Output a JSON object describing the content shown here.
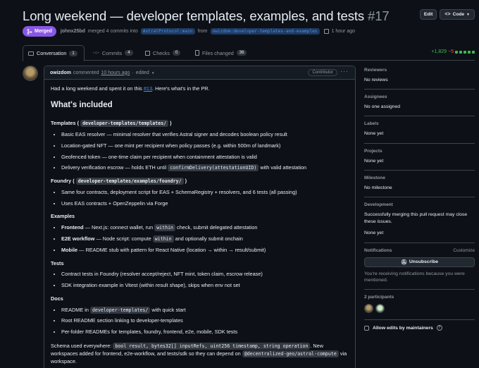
{
  "pr": {
    "title": "Long weekend — developer templates, examples, and tests",
    "number": "#17",
    "state": "Merged",
    "author": "johnx25bd",
    "merged_text": "merged 4 commits into",
    "base_branch": "AstralProtocol:main",
    "from_text": "from",
    "head_branch": "owizdom:developer-templates-and-examples",
    "time": "1 hour ago"
  },
  "header_buttons": {
    "edit": "Edit",
    "code": "Code"
  },
  "tabs": [
    {
      "label": "Conversation",
      "count": "1"
    },
    {
      "label": "Commits",
      "count": "4"
    },
    {
      "label": "Checks",
      "count": "0"
    },
    {
      "label": "Files changed",
      "count": "36"
    }
  ],
  "diffstat": {
    "additions": "+1,829",
    "deletions": "−5"
  },
  "comment": {
    "author": "owizdom",
    "action": "commented",
    "time": "10 hours ago",
    "sep": "·",
    "edited": "edited",
    "role": "Contributor",
    "intro_pre": "Had a long weekend and spent it on this ",
    "intro_link": "#13",
    "intro_post": ". Here's what's in the PR.",
    "heading": "What's included",
    "templates": {
      "label": "Templates",
      "path": "developer-templates/templates/",
      "items": [
        "Basic EAS resolver — minimal resolver that verifies Astral signer and decodes boolean policy result",
        "Location-gated NFT — one mint per recipient when policy passes (e.g. within 500m of landmark)",
        "Geofenced token — one-time claim per recipient when containment attestation is valid"
      ],
      "escrow_pre": "Delivery verification escrow — holds ETH until ",
      "escrow_code": "confirmDelivery(attestationUID)",
      "escrow_post": " with valid attestation"
    },
    "foundry": {
      "label": "Foundry",
      "path": "developer-templates/examples/foundry/",
      "items": [
        "Same four contracts, deployment script for EAS + SchemaRegistry + resolvers, and 6 tests (all passing)",
        "Uses EAS contracts + OpenZeppelin via Forge"
      ]
    },
    "examples": {
      "label": "Examples",
      "frontend_b": "Frontend",
      "frontend_pre": " — Next.js: connect wallet, run ",
      "frontend_code": "within",
      "frontend_post": " check, submit delegated attestation",
      "e2e_b": "E2E workflow",
      "e2e_pre": " — Node script: compute ",
      "e2e_code": "within",
      "e2e_post": " and optionally submit onchain",
      "mobile_b": "Mobile",
      "mobile_post": " — README stub with pattern for React Native (location → within → result/submit)"
    },
    "tests": {
      "label": "Tests",
      "items": [
        "Contract tests in Foundry (resolver accept/reject, NFT mint, token claim, escrow release)",
        "SDK integration example in Vitest (within result shape), skips when env not set"
      ]
    },
    "docs": {
      "label": "Docs",
      "readme_pre": "README in ",
      "readme_code": "developer-templates/",
      "readme_post": " with quick start",
      "items": [
        "Root README section linking to developer-templates",
        "Per-folder READMEs for templates, foundry, frontend, e2e, mobile, SDK tests"
      ]
    },
    "schema": {
      "pre": "Schema used everywhere: ",
      "code": "bool result, bytes32[] inputRefs, uint256 timestamp, string operation",
      "mid": ". New workspaces added for frontend, e2e-workflow, and tests/sdk so they can depend on ",
      "code2": "@decentralized-geo/astral-compute",
      "post": " via workspace."
    }
  },
  "sidebar": {
    "reviewers": {
      "title": "Reviewers",
      "value": "No reviews"
    },
    "assignees": {
      "title": "Assignees",
      "value": "No one assigned"
    },
    "labels": {
      "title": "Labels",
      "value": "None yet"
    },
    "projects": {
      "title": "Projects",
      "value": "None yet"
    },
    "milestone": {
      "title": "Milestone",
      "value": "No milestone"
    },
    "development": {
      "title": "Development",
      "text": "Successfully merging this pull request may close these issues.",
      "value": "None yet"
    },
    "notifications": {
      "title": "Notifications",
      "customize": "Customize",
      "button": "Unsubscribe",
      "text": "You're receiving notifications because you were mentioned."
    },
    "participants": {
      "title": "2 participants"
    },
    "maintainers": {
      "label": "Allow edits by maintainers"
    }
  },
  "colors": {
    "merged": "#8957e5",
    "link": "#4493f8",
    "add": "#3fb950",
    "del": "#f85149"
  }
}
